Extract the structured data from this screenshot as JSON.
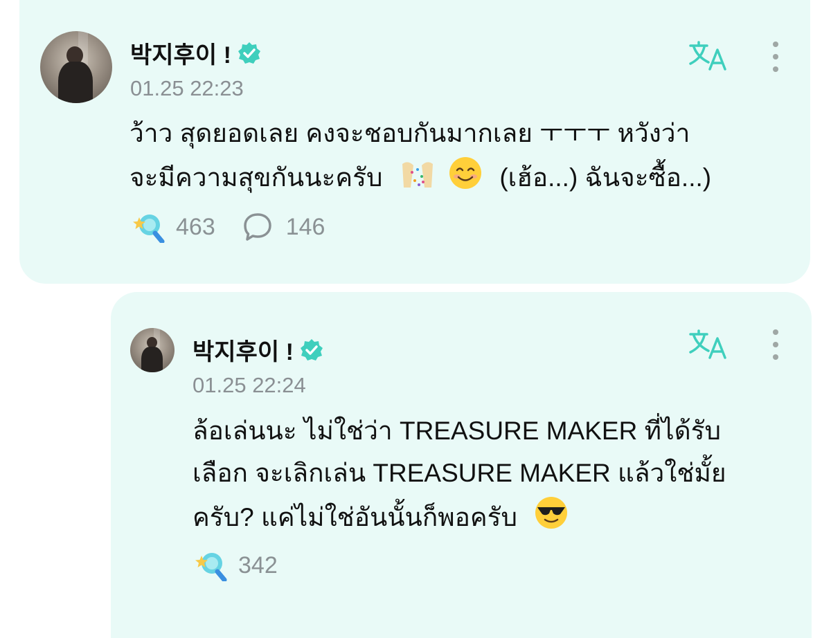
{
  "post": {
    "author": "박지후이 !",
    "timestamp": "01.25 22:23",
    "text_line1": "ว้าว สุดยอดเลย คงจะชอบกันมากเลย ㅜㅜㅜ หวังว่า",
    "text_line2a": "จะมีความสุขกันนะครับ",
    "text_line2b": "(เฮ้อ...) ฉันจะซื้อ...)",
    "likes": "463",
    "comments": "146"
  },
  "reply": {
    "author": "박지후이 !",
    "timestamp": "01.25 22:24",
    "text_line1": "ล้อเล่นนะ ไม่ใช่ว่า TREASURE MAKER ที่ได้รับ",
    "text_line2": "เลือก จะเลิกเล่น TREASURE MAKER แล้วใช่มั้ย",
    "text_line3": "ครับ? แค่ไม่ใช่อันนั้นก็พอครับ",
    "likes": "342"
  },
  "icons": {
    "verified": "verified-badge-icon",
    "translate": "translate-icon",
    "more": "more-vertical-icon",
    "like": "sparkle-light-stick-icon",
    "comment": "comment-bubble-icon",
    "party": "party-popper-emoji",
    "smile": "smiling-face-emoji",
    "sunglasses": "sunglasses-face-emoji"
  },
  "colors": {
    "card_bg": "#e9faf7",
    "accent": "#3fcfbd",
    "muted": "#8a9194"
  }
}
